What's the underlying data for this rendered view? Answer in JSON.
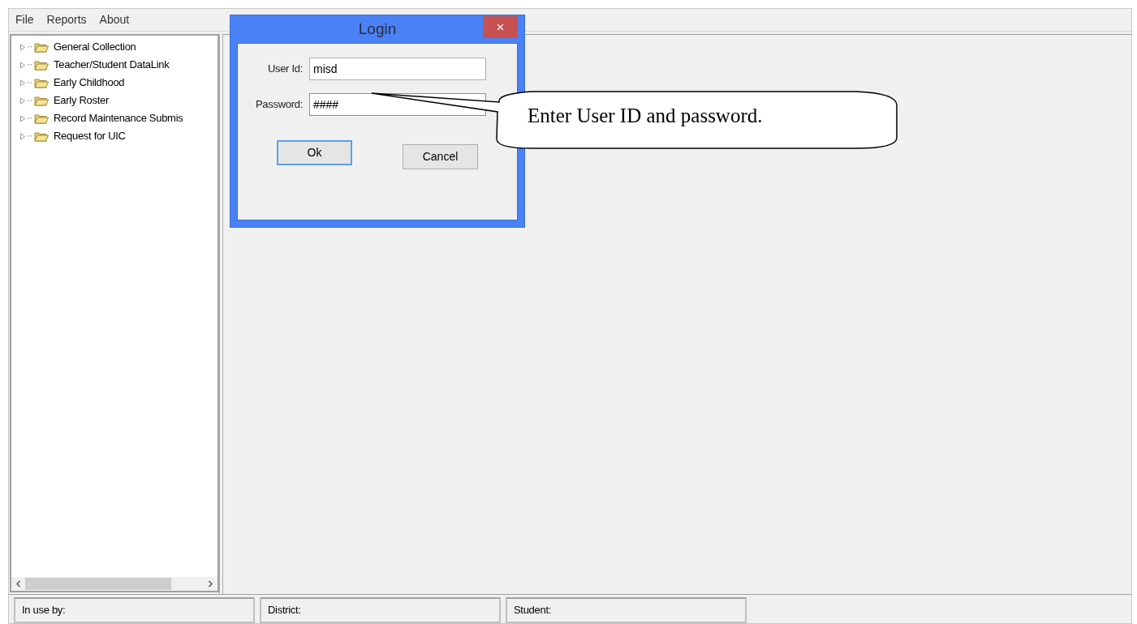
{
  "menu": [
    "File",
    "Reports",
    "About"
  ],
  "tree": [
    {
      "label": "General Collection",
      "expanded": false
    },
    {
      "label": "Teacher/Student DataLink",
      "expanded": false
    },
    {
      "label": "Early Childhood",
      "expanded": false
    },
    {
      "label": "Early Roster",
      "expanded": false
    },
    {
      "label": "Record Maintenance Submis",
      "expanded": false
    },
    {
      "label": "Request for UIC",
      "expanded": false
    }
  ],
  "status_bar": [
    "In use by:",
    "District:",
    "Student:"
  ],
  "dialog": {
    "title": "Login",
    "close": "×",
    "fields": [
      {
        "label": "User Id:",
        "value": "misd",
        "focused": false
      },
      {
        "label": "Password:",
        "value": "####",
        "focused": true
      }
    ],
    "buttons": [
      {
        "label": "Ok",
        "default": true
      },
      {
        "label": "Cancel",
        "default": false
      }
    ]
  },
  "callout": "Enter User ID and password."
}
